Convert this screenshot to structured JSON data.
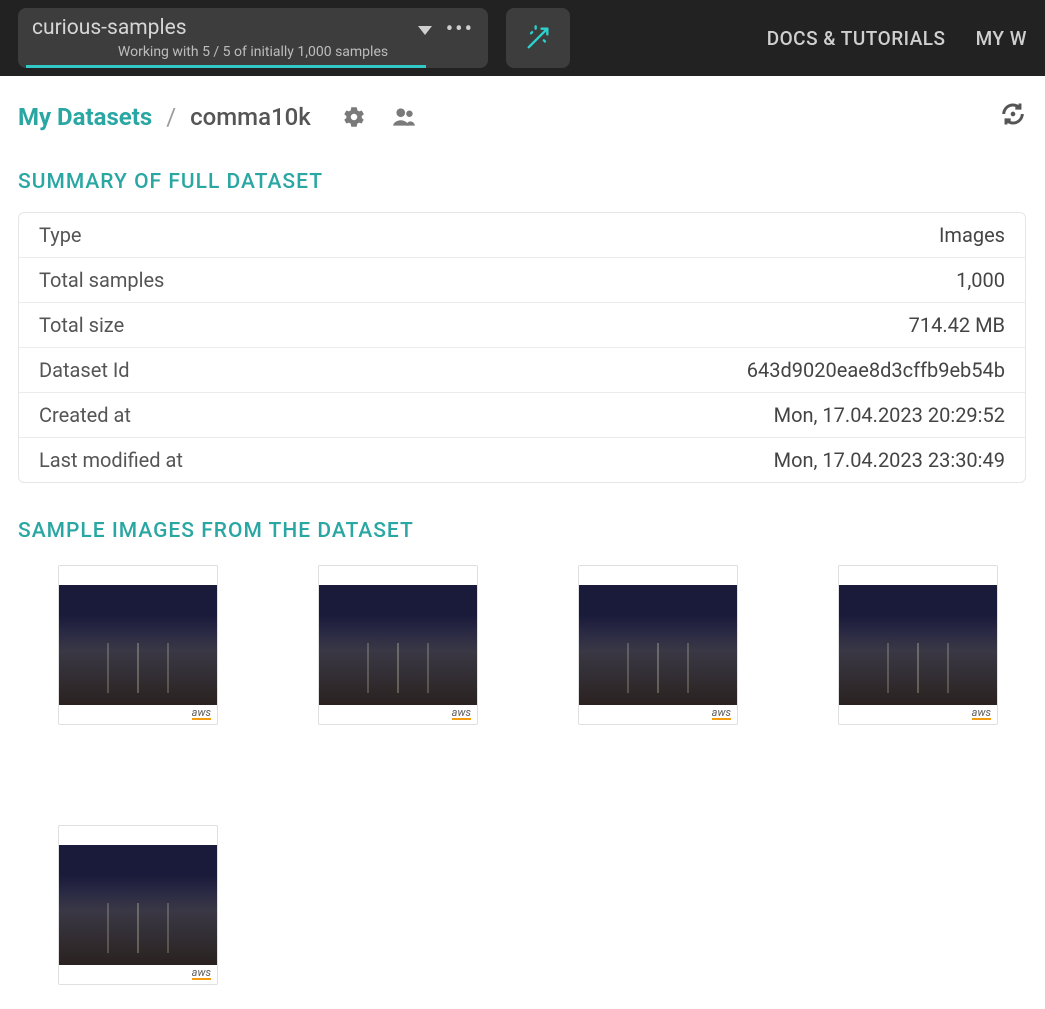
{
  "topbar": {
    "selector_title": "curious-samples",
    "selector_sub": "Working with 5 / 5 of initially 1,000 samples",
    "nav": {
      "docs": "DOCS & TUTORIALS",
      "my": "MY W"
    }
  },
  "breadcrumb": {
    "root": "My Datasets",
    "sep": "/",
    "name": "comma10k"
  },
  "sections": {
    "summary_title": "SUMMARY OF FULL DATASET",
    "samples_title": "SAMPLE IMAGES FROM THE DATASET"
  },
  "summary": [
    {
      "label": "Type",
      "value": "Images"
    },
    {
      "label": "Total samples",
      "value": "1,000"
    },
    {
      "label": "Total size",
      "value": "714.42 MB"
    },
    {
      "label": "Dataset Id",
      "value": "643d9020eae8d3cffb9eb54b"
    },
    {
      "label": "Created at",
      "value": "Mon, 17.04.2023 20:29:52"
    },
    {
      "label": "Last modified at",
      "value": "Mon, 17.04.2023 23:30:49"
    }
  ],
  "thumbs": {
    "provider_label": "aws",
    "count": 5
  }
}
